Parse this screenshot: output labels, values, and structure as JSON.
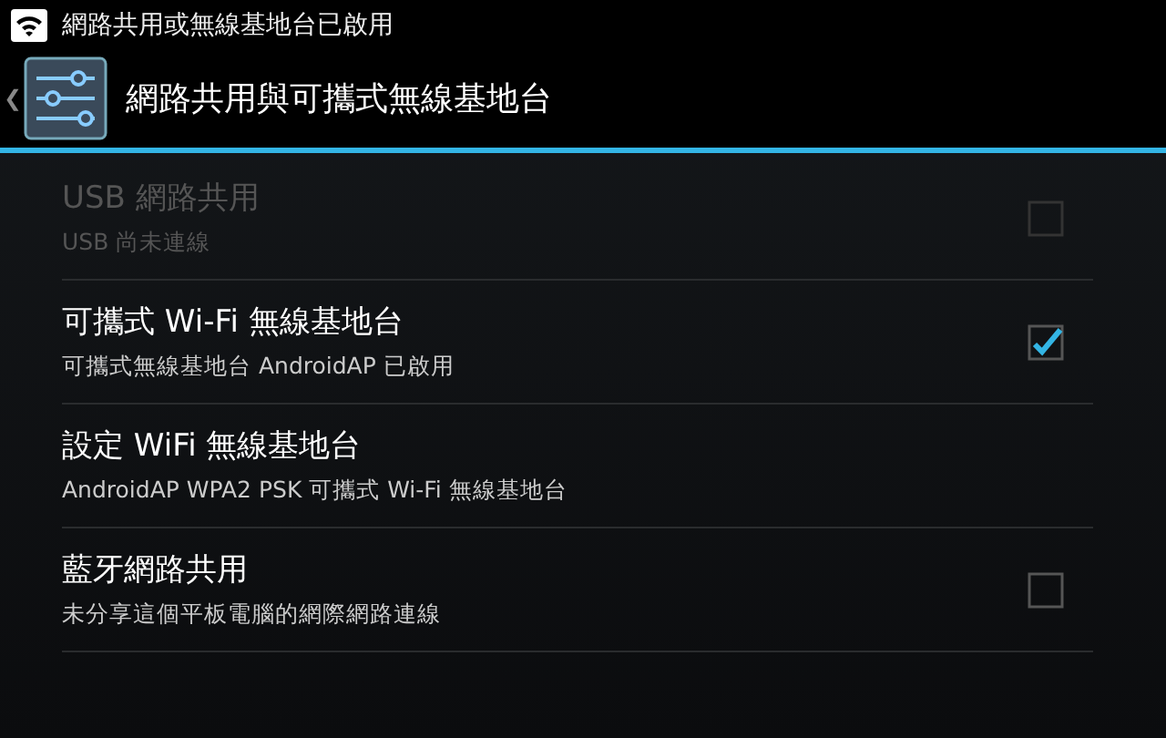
{
  "status_bar": {
    "notification": "網路共用或無線基地台已啟用"
  },
  "action_bar": {
    "back": "❮",
    "title": "網路共用與可攜式無線基地台"
  },
  "items": [
    {
      "kind": "checkbox",
      "title": "USB 網路共用",
      "summary": "USB 尚未連線",
      "disabled": true,
      "checked": false
    },
    {
      "kind": "checkbox",
      "title": "可攜式 Wi-Fi 無線基地台",
      "summary": "可攜式無線基地台 AndroidAP 已啟用",
      "disabled": false,
      "checked": true
    },
    {
      "kind": "plain",
      "title": "設定 WiFi 無線基地台",
      "summary": "AndroidAP WPA2 PSK 可攜式 Wi-Fi 無線基地台",
      "disabled": false
    },
    {
      "kind": "checkbox",
      "title": "藍牙網路共用",
      "summary": "未分享這個平板電腦的網際網路連線",
      "disabled": false,
      "checked": false
    }
  ]
}
